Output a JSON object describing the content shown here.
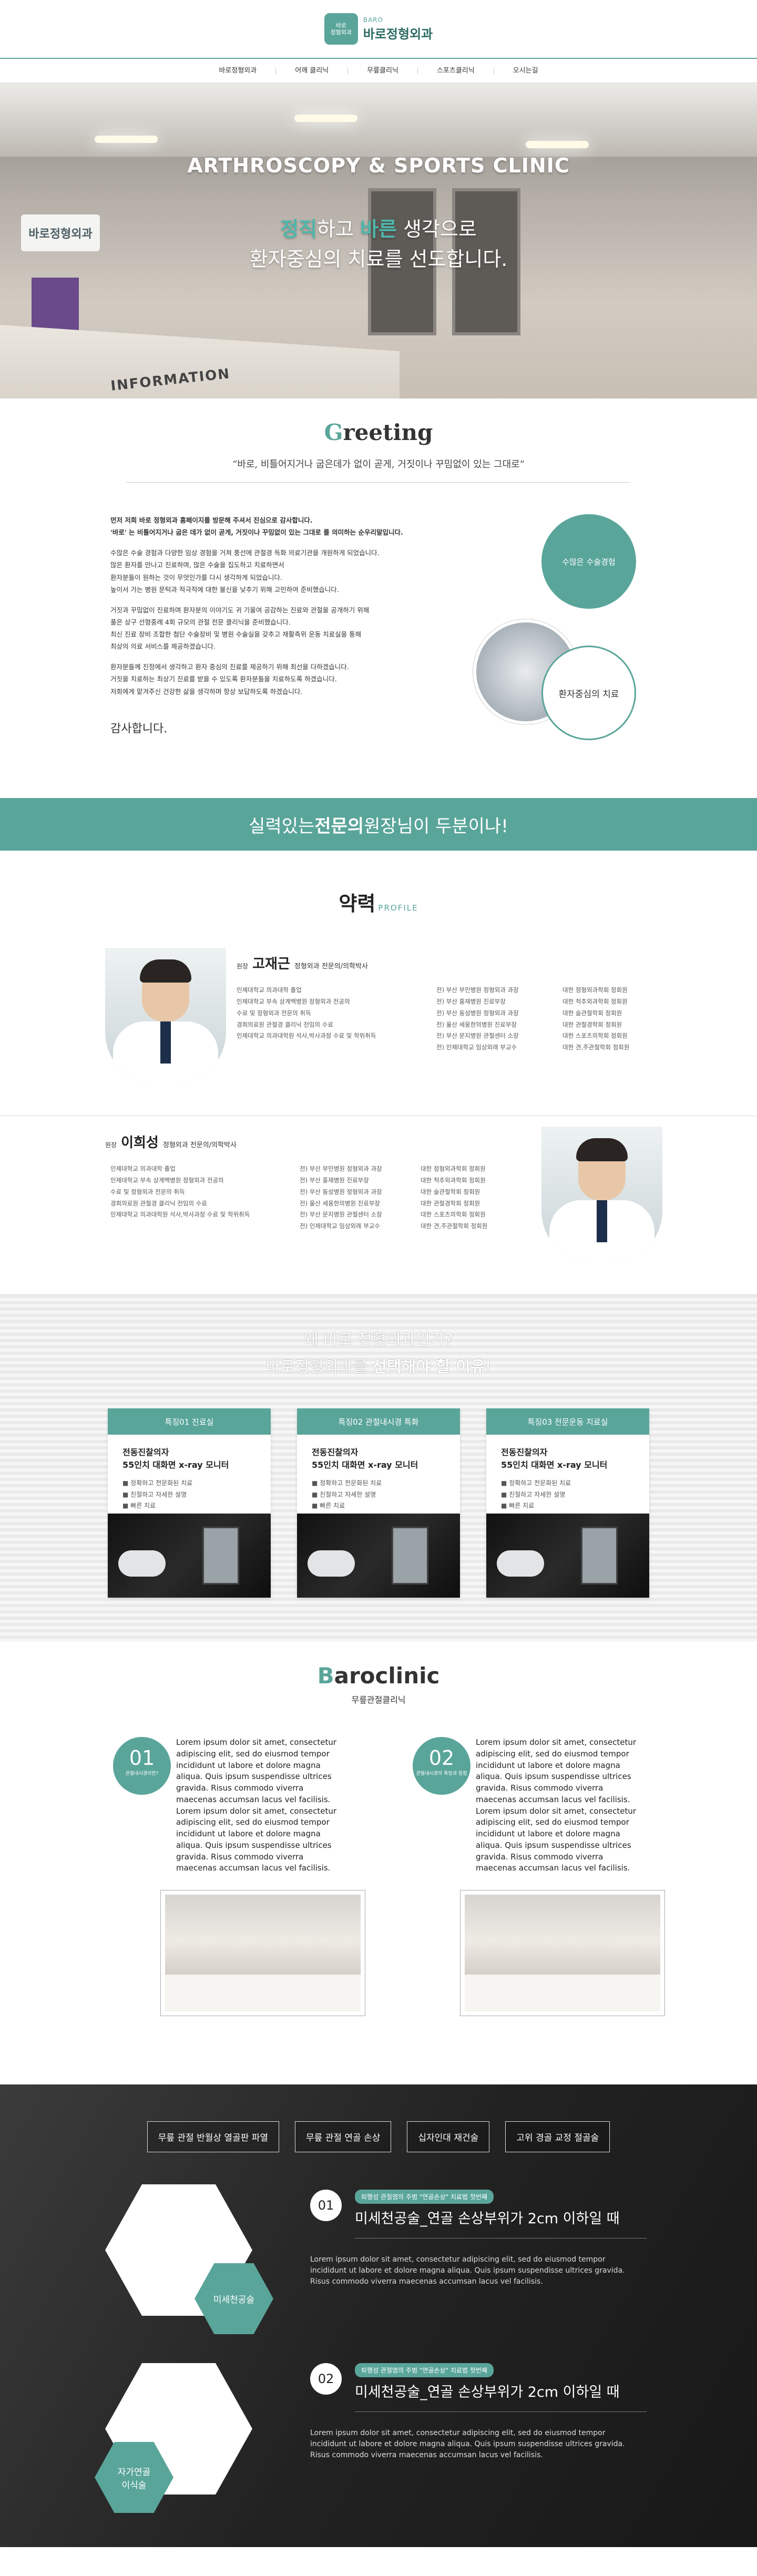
{
  "header": {
    "logo_mark": "바로\n정형외과",
    "logo_en": "BARO",
    "logo_ko": "바로정형외과"
  },
  "nav": [
    "바로정형외과",
    "어깨 클리닉",
    "무릎클리닉",
    "스포츠클리닉",
    "오시는길"
  ],
  "hero": {
    "title": "ARTHROSCOPY & SPORTS CLINIC",
    "sub_hl1": "정직",
    "sub_mid1": "하고 ",
    "sub_hl2": "바른",
    "sub_mid2": " 생각으로",
    "sub_line2": "환자중심의 치료를 선도합니다.",
    "wall_logo": "바로정형외과",
    "desk_sign": "INFORMATION"
  },
  "greeting": {
    "title_first": "G",
    "title_rest": "reeting",
    "quote": "“바로, 비틀어지거나 굽은데가 없이 곧게, 거짓이나 꾸밈없이 있는 그대로”",
    "paragraphs": [
      "먼저 저희 바로 정형외과 홈페이지를 방문해 주셔서 진심으로 감사합니다.\n'바로' 는 비틀어지거나 굽은 데가 없이 곧게, 거짓이나 꾸밈없이 있는 그대로 를 의미하는 순우리말입니다.",
      "수많은 수술 경험과 다양한 임상 경험을 거쳐 풍선에 관절경 득화 의료기관을 개원하게 되었습니다.\n많은 환자를 만나고 진료하며, 많은 수술을 집도하고 치료하면서\n환자분들이 원하는 것이 무엇인가를 다시 생각하게 되었습니다.\n높이서 가는 병원 문턱과 적극적에 대한 불신을 낮추기 위해 고민하여 준비했습니다.",
      "거짓과 꾸밈없이 진료하며 환자분의 이야기도 귀 기울여 공감하는 진료와 관절을 공개하기 위해\n풀은 상구 선형중례 4회 규모의 관절 전문 클리닉을 준비했습니다.\n최신 진료 장비 조합한 첨단 수술장비 및 병원 수술실을 갖추고 재활측위 운동 치료실을 통해\n최상의 의료 서비스를 제공하겠습니다.",
      "환자분들께 진정에서 생각하고 환자 중심의 진료를 제공하기 위해 최선을 다하겠습니다.\n거짓을 치료하는 최상기 진료를 받을 수 있도록 환자분들을 치료하도록 하겠습니다.\n저희에게 맡겨주신 건강한 삶을 생각하며 항상 보답하도록 하겠습니다."
    ],
    "sign": "감사합니다.",
    "circle1": "수많은 수술경험",
    "circle3": "환자중심의 치료"
  },
  "banner": {
    "pre": "실력있는 ",
    "bold": "전문의",
    "post": " 원장님이 두분이나!"
  },
  "profile": {
    "title": "약력",
    "title_en": "PROFILE",
    "doctors": [
      {
        "role": "원장",
        "name": "고재근",
        "desc": "정형외과 전문의/의학박사",
        "col1": [
          "인제대학교 의과대학 졸업",
          "인제대학교 부속 상계백병원 정형외과 전공의",
          "수료 및 정형외과 전문의 취득",
          "경희의료원 관절경 클리닉 전임의 수료",
          "인제대학교 의과대학원 석사,박사과정 수료 및 학위취득"
        ],
        "col2": [
          "전) 부산 부민병원 정형외과 과장",
          "전) 부산 홍재병원 진료부장",
          "전) 부산 동성병원 정형외과 과장",
          "전) 울산 세웅한의병원 진료부장",
          "전) 부산 문지병원 관절센터 소장",
          "전) 인제대학교 임상외래 부교수"
        ],
        "col3": [
          "대한 정형외과학회 정회원",
          "대한 척추외과학회 정회원",
          "대한 슬관절학회 정회원",
          "대한 관절경학회 정회원",
          "대한 스포츠의학회 정회원",
          "대한 견,주관절학회 정회원"
        ]
      },
      {
        "role": "원장",
        "name": "이희성",
        "desc": "정형외과 전문의/의학박사",
        "col1": [
          "인제대학교 의과대학 졸업",
          "인제대학교 부속 상계백병원 정형외과 전공의",
          "수료 및 정형외과 전문의 취득",
          "경희의료원 관절경 클리닉 전임의 수료",
          "인제대학교 의과대학원 석사,박사과정 수료 및 학위취득"
        ],
        "col2": [
          "전) 부산 부민병원 정형외과 과장",
          "전) 부산 홍재병원 진료부장",
          "전) 부산 동성병원 정형외과 과장",
          "전) 울산 세웅한의병원 진료부장",
          "전) 부산 문지병원 관절센터 소장",
          "전) 인제대학교 임상외래 부교수"
        ],
        "col3": [
          "대한 정형외과학회 정회원",
          "대한 척추외과학회 정회원",
          "대한 슬관절학회 정회원",
          "대한 관절경학회 정회원",
          "대한 스포츠의학회 정회원",
          "대한 견,주관절학회 정회원"
        ]
      }
    ]
  },
  "why": {
    "line1": "왜 바로 정형외과인가?",
    "line2_pre": "바로정형외과를 ",
    "line2_bold": "선택해야 할 이유",
    "line2_post": "!",
    "cards": [
      {
        "head": "특징01 진료실",
        "title": "전동진찰의자\n55인치 대화면 x-ray 모니터",
        "items": [
          "■ 정확하고 전문화된 치료",
          "■ 친절하고 자세한 설명",
          "■ 빠른 치료"
        ]
      },
      {
        "head": "특징02 관절내시경 특화",
        "title": "전동진찰의자\n55인치 대화면 x-ray 모니터",
        "items": [
          "■ 정확하고 전문화된 치료",
          "■ 친절하고 자세한 설명",
          "■ 빠른 치료"
        ]
      },
      {
        "head": "특징03 전문운동 치료실",
        "title": "전동진찰의자\n55인치 대화면 x-ray 모니터",
        "items": [
          "■ 정확하고 전문화된 치료",
          "■ 친절하고 자세한 설명",
          "■ 빠른 치료"
        ]
      }
    ]
  },
  "baroclinic": {
    "title_first": "B",
    "title_rest": "aroclinic",
    "sub": "무릎관절클리닉",
    "cols": [
      {
        "num": "01",
        "small": "관절내시경이란?",
        "text": "Lorem ipsum dolor sit amet, consectetur adipiscing elit, sed do eiusmod tempor incididunt ut labore et dolore magna aliqua. Quis ipsum suspendisse ultrices gravida. Risus commodo viverra maecenas accumsan lacus vel facilisis.\nLorem ipsum dolor sit amet, consectetur adipiscing elit, sed do eiusmod tempor incididunt ut labore et dolore magna aliqua. Quis ipsum suspendisse ultrices gravida. Risus commodo viverra maecenas accumsan lacus vel facilisis."
      },
      {
        "num": "02",
        "small": "관절내시경의 특징과 장점",
        "text": "Lorem ipsum dolor sit amet, consectetur adipiscing elit, sed do eiusmod tempor incididunt ut labore et dolore magna aliqua. Quis ipsum suspendisse ultrices gravida. Risus commodo viverra maecenas accumsan lacus vel facilisis.\nLorem ipsum dolor sit amet, consectetur adipiscing elit, sed do eiusmod tempor incididunt ut labore et dolore magna aliqua. Quis ipsum suspendisse ultrices gravida. Risus commodo viverra maecenas accumsan lacus vel facilisis."
      }
    ]
  },
  "treatment": {
    "tabs": [
      "무릎 관절 반월상 열골판 파열",
      "무릎 관절 연골 손상",
      "십자인대 재건술",
      "고위 경골 교정 절골술"
    ],
    "hex1": "미세천공술",
    "hex2": "자가연골\n이식술",
    "rows": [
      {
        "num": "01",
        "pill": "퇴행성 관절염의 주범 \"연골손상\" 치료법 첫번째",
        "title": "미세천공술_연골 손상부위가 2cm 이하일 때",
        "desc": "Lorem ipsum dolor sit amet, consectetur adipiscing elit, sed do eiusmod tempor incididunt ut labore et dolore magna aliqua. Quis ipsum suspendisse ultrices gravida. Risus commodo viverra maecenas accumsan lacus vel facilisis."
      },
      {
        "num": "02",
        "pill": "퇴행성 관절염의 주범 \"연골손상\" 치료법 첫번째",
        "title": "미세천공술_연골 손상부위가 2cm 이하일 때",
        "desc": "Lorem ipsum dolor sit amet, consectetur adipiscing elit, sed do eiusmod tempor incididunt ut labore et dolore magna aliqua. Quis ipsum suspendisse ultrices gravida. Risus commodo viverra maecenas accumsan lacus vel facilisis."
      }
    ]
  },
  "colors": {
    "accent": "#5aa59a",
    "dark": "#222222"
  }
}
